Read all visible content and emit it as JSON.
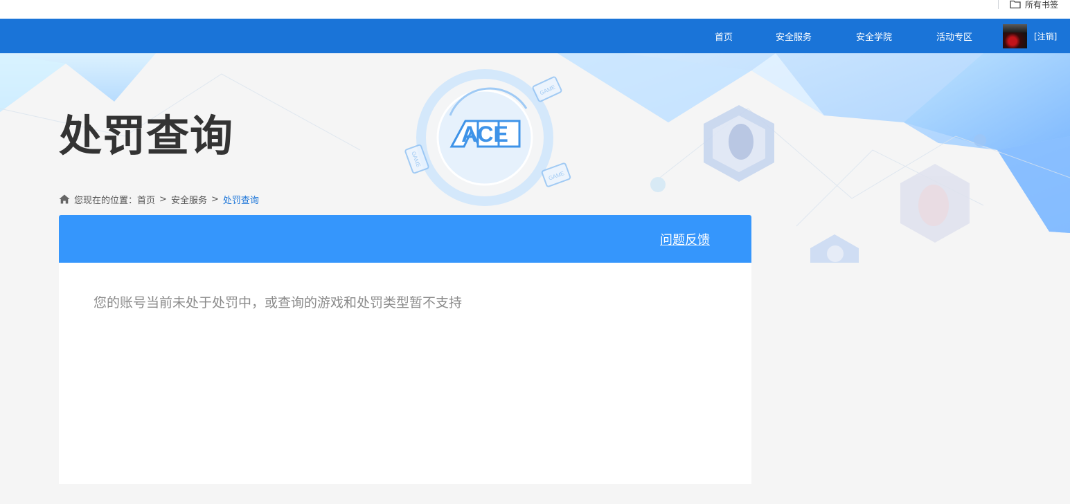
{
  "browser": {
    "bookmarks_all_label": "所有书签"
  },
  "nav": {
    "items": [
      {
        "label": "首页"
      },
      {
        "label": "安全服务"
      },
      {
        "label": "安全学院"
      },
      {
        "label": "活动专区"
      }
    ],
    "logout_label": "[注销]",
    "avatar": "user-avatar"
  },
  "hero": {
    "title": "处罚查询",
    "logo_text": "ACE",
    "game_badge": "GAME"
  },
  "breadcrumb": {
    "prefix": "您现在的位置：",
    "items": [
      {
        "label": "首页"
      },
      {
        "label": "安全服务"
      }
    ],
    "current": "处罚查询",
    "separator": ">"
  },
  "card": {
    "feedback_label": "问题反馈",
    "message": "您的账号当前未处于处罚中，或查询的游戏和处罚类型暂不支持"
  },
  "colors": {
    "nav_bg": "#1a74d8",
    "card_header_bg": "#3596fc",
    "page_bg": "#f5f5f5",
    "title_text": "#333333",
    "message_text": "#8a8a8a"
  }
}
